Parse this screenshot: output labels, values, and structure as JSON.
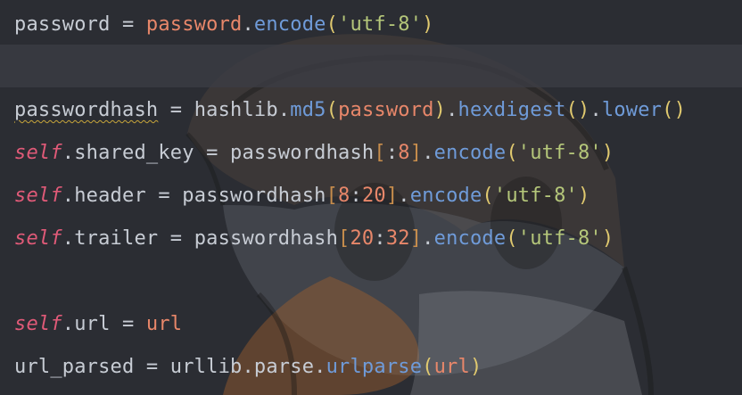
{
  "editor": {
    "lines": [
      {
        "tokens": [
          {
            "t": "password",
            "c": "plain"
          },
          {
            "t": " = ",
            "c": "op"
          },
          {
            "t": "password",
            "c": "var"
          },
          {
            "t": ".",
            "c": "plain"
          },
          {
            "t": "encode",
            "c": "fn"
          },
          {
            "t": "(",
            "c": "paren"
          },
          {
            "t": "'utf-8'",
            "c": "str"
          },
          {
            "t": ")",
            "c": "paren"
          }
        ]
      },
      {
        "tokens": []
      },
      {
        "tokens": [
          {
            "t": "passwordhash",
            "c": "plain warn"
          },
          {
            "t": " = ",
            "c": "op"
          },
          {
            "t": "hashlib",
            "c": "plain"
          },
          {
            "t": ".",
            "c": "plain"
          },
          {
            "t": "md5",
            "c": "fn"
          },
          {
            "t": "(",
            "c": "paren"
          },
          {
            "t": "password",
            "c": "var"
          },
          {
            "t": ")",
            "c": "paren"
          },
          {
            "t": ".",
            "c": "plain"
          },
          {
            "t": "hexdigest",
            "c": "fn"
          },
          {
            "t": "()",
            "c": "paren"
          },
          {
            "t": ".",
            "c": "plain"
          },
          {
            "t": "lower",
            "c": "fn"
          },
          {
            "t": "()",
            "c": "paren"
          }
        ]
      },
      {
        "tokens": [
          {
            "t": "self",
            "c": "kw-self"
          },
          {
            "t": ".shared_key",
            "c": "plain"
          },
          {
            "t": " = ",
            "c": "op"
          },
          {
            "t": "passwordhash",
            "c": "plain"
          },
          {
            "t": "[",
            "c": "bracket"
          },
          {
            "t": ":",
            "c": "plain"
          },
          {
            "t": "8",
            "c": "num"
          },
          {
            "t": "]",
            "c": "bracket"
          },
          {
            "t": ".",
            "c": "plain"
          },
          {
            "t": "encode",
            "c": "fn"
          },
          {
            "t": "(",
            "c": "paren"
          },
          {
            "t": "'utf-8'",
            "c": "str"
          },
          {
            "t": ")",
            "c": "paren"
          }
        ]
      },
      {
        "tokens": [
          {
            "t": "self",
            "c": "kw-self"
          },
          {
            "t": ".header",
            "c": "plain"
          },
          {
            "t": " = ",
            "c": "op"
          },
          {
            "t": "passwordhash",
            "c": "plain"
          },
          {
            "t": "[",
            "c": "bracket"
          },
          {
            "t": "8",
            "c": "num"
          },
          {
            "t": ":",
            "c": "plain"
          },
          {
            "t": "20",
            "c": "num"
          },
          {
            "t": "]",
            "c": "bracket"
          },
          {
            "t": ".",
            "c": "plain"
          },
          {
            "t": "encode",
            "c": "fn"
          },
          {
            "t": "(",
            "c": "paren"
          },
          {
            "t": "'utf-8'",
            "c": "str"
          },
          {
            "t": ")",
            "c": "paren"
          }
        ]
      },
      {
        "tokens": [
          {
            "t": "self",
            "c": "kw-self"
          },
          {
            "t": ".trailer",
            "c": "plain"
          },
          {
            "t": " = ",
            "c": "op"
          },
          {
            "t": "passwordhash",
            "c": "plain"
          },
          {
            "t": "[",
            "c": "bracket"
          },
          {
            "t": "20",
            "c": "num"
          },
          {
            "t": ":",
            "c": "plain"
          },
          {
            "t": "32",
            "c": "num"
          },
          {
            "t": "]",
            "c": "bracket"
          },
          {
            "t": ".",
            "c": "plain"
          },
          {
            "t": "encode",
            "c": "fn"
          },
          {
            "t": "(",
            "c": "paren"
          },
          {
            "t": "'utf-8'",
            "c": "str"
          },
          {
            "t": ")",
            "c": "paren"
          }
        ]
      },
      {
        "tokens": []
      },
      {
        "tokens": [
          {
            "t": "self",
            "c": "kw-self"
          },
          {
            "t": ".url",
            "c": "plain"
          },
          {
            "t": " = ",
            "c": "op"
          },
          {
            "t": "url",
            "c": "var"
          }
        ]
      },
      {
        "tokens": [
          {
            "t": "url_parsed",
            "c": "plain"
          },
          {
            "t": " = ",
            "c": "op"
          },
          {
            "t": "urllib",
            "c": "plain"
          },
          {
            "t": ".parse.",
            "c": "plain"
          },
          {
            "t": "urlparse",
            "c": "fn"
          },
          {
            "t": "(",
            "c": "paren"
          },
          {
            "t": "url",
            "c": "var"
          },
          {
            "t": ")",
            "c": "paren"
          }
        ]
      }
    ],
    "current_line_index": 1
  },
  "colors": {
    "background": "#2b2d33",
    "self_keyword": "#e05a78",
    "string": "#b5c77a",
    "function": "#6f9bd9",
    "number": "#e8876a",
    "paren": "#e0c96f",
    "bracket": "#c78d4c",
    "text": "#c7ccd4"
  }
}
